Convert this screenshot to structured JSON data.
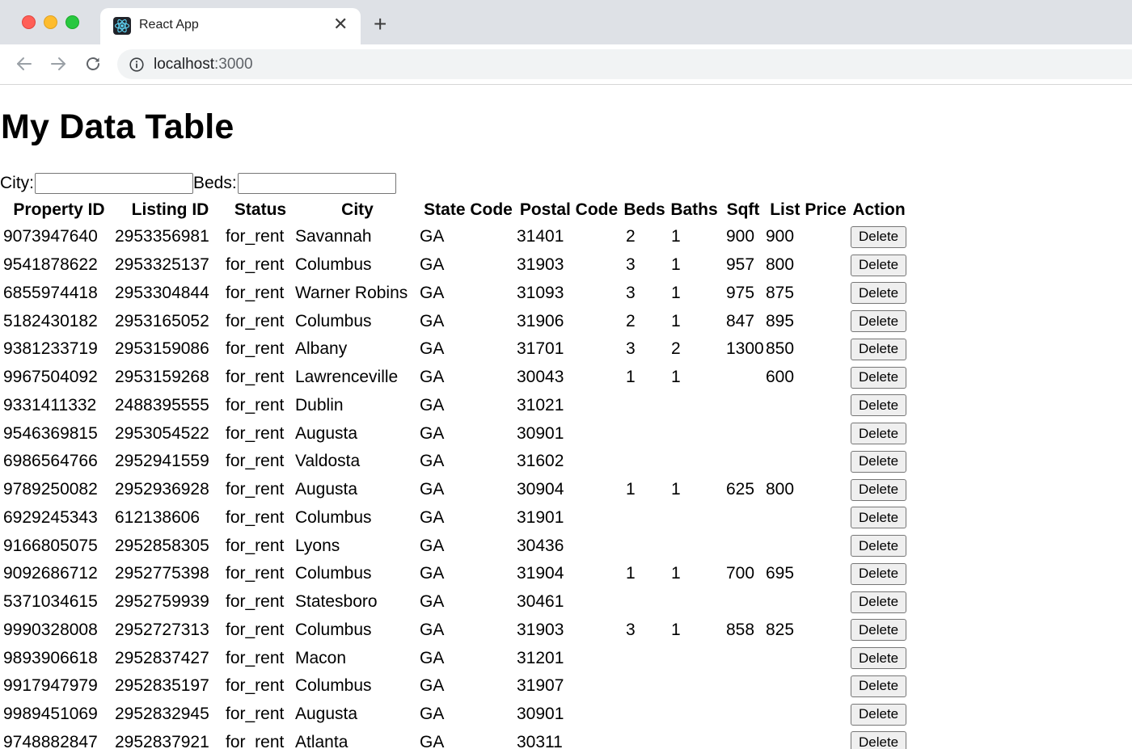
{
  "browser": {
    "tab_title": "React App",
    "tab_close": "✕",
    "new_tab": "+",
    "url_host": "localhost",
    "url_port": ":3000"
  },
  "page": {
    "title": "My Data Table",
    "filters": {
      "city_label": "City:",
      "city_value": "",
      "beds_label": "Beds:",
      "beds_value": ""
    },
    "columns": [
      "Property ID",
      "Listing ID",
      "Status",
      "City",
      "State Code",
      "Postal Code",
      "Beds",
      "Baths",
      "Sqft",
      "List Price",
      "Action"
    ],
    "delete_label": "Delete",
    "rows": [
      {
        "property_id": "9073947640",
        "listing_id": "2953356981",
        "status": "for_rent",
        "city": "Savannah",
        "state": "GA",
        "postal": "31401",
        "beds": "2",
        "baths": "1",
        "sqft": "900",
        "price": "900"
      },
      {
        "property_id": "9541878622",
        "listing_id": "2953325137",
        "status": "for_rent",
        "city": "Columbus",
        "state": "GA",
        "postal": "31903",
        "beds": "3",
        "baths": "1",
        "sqft": "957",
        "price": "800"
      },
      {
        "property_id": "6855974418",
        "listing_id": "2953304844",
        "status": "for_rent",
        "city": "Warner Robins",
        "state": "GA",
        "postal": "31093",
        "beds": "3",
        "baths": "1",
        "sqft": "975",
        "price": "875"
      },
      {
        "property_id": "5182430182",
        "listing_id": "2953165052",
        "status": "for_rent",
        "city": "Columbus",
        "state": "GA",
        "postal": "31906",
        "beds": "2",
        "baths": "1",
        "sqft": "847",
        "price": "895"
      },
      {
        "property_id": "9381233719",
        "listing_id": "2953159086",
        "status": "for_rent",
        "city": "Albany",
        "state": "GA",
        "postal": "31701",
        "beds": "3",
        "baths": "2",
        "sqft": "1300",
        "price": "850"
      },
      {
        "property_id": "9967504092",
        "listing_id": "2953159268",
        "status": "for_rent",
        "city": "Lawrenceville",
        "state": "GA",
        "postal": "30043",
        "beds": "1",
        "baths": "1",
        "sqft": "",
        "price": "600"
      },
      {
        "property_id": "9331411332",
        "listing_id": "2488395555",
        "status": "for_rent",
        "city": "Dublin",
        "state": "GA",
        "postal": "31021",
        "beds": "",
        "baths": "",
        "sqft": "",
        "price": ""
      },
      {
        "property_id": "9546369815",
        "listing_id": "2953054522",
        "status": "for_rent",
        "city": "Augusta",
        "state": "GA",
        "postal": "30901",
        "beds": "",
        "baths": "",
        "sqft": "",
        "price": ""
      },
      {
        "property_id": "6986564766",
        "listing_id": "2952941559",
        "status": "for_rent",
        "city": "Valdosta",
        "state": "GA",
        "postal": "31602",
        "beds": "",
        "baths": "",
        "sqft": "",
        "price": ""
      },
      {
        "property_id": "9789250082",
        "listing_id": "2952936928",
        "status": "for_rent",
        "city": "Augusta",
        "state": "GA",
        "postal": "30904",
        "beds": "1",
        "baths": "1",
        "sqft": "625",
        "price": "800"
      },
      {
        "property_id": "6929245343",
        "listing_id": "612138606",
        "status": "for_rent",
        "city": "Columbus",
        "state": "GA",
        "postal": "31901",
        "beds": "",
        "baths": "",
        "sqft": "",
        "price": ""
      },
      {
        "property_id": "9166805075",
        "listing_id": "2952858305",
        "status": "for_rent",
        "city": "Lyons",
        "state": "GA",
        "postal": "30436",
        "beds": "",
        "baths": "",
        "sqft": "",
        "price": ""
      },
      {
        "property_id": "9092686712",
        "listing_id": "2952775398",
        "status": "for_rent",
        "city": "Columbus",
        "state": "GA",
        "postal": "31904",
        "beds": "1",
        "baths": "1",
        "sqft": "700",
        "price": "695"
      },
      {
        "property_id": "5371034615",
        "listing_id": "2952759939",
        "status": "for_rent",
        "city": "Statesboro",
        "state": "GA",
        "postal": "30461",
        "beds": "",
        "baths": "",
        "sqft": "",
        "price": ""
      },
      {
        "property_id": "9990328008",
        "listing_id": "2952727313",
        "status": "for_rent",
        "city": "Columbus",
        "state": "GA",
        "postal": "31903",
        "beds": "3",
        "baths": "1",
        "sqft": "858",
        "price": "825"
      },
      {
        "property_id": "9893906618",
        "listing_id": "2952837427",
        "status": "for_rent",
        "city": "Macon",
        "state": "GA",
        "postal": "31201",
        "beds": "",
        "baths": "",
        "sqft": "",
        "price": ""
      },
      {
        "property_id": "9917947979",
        "listing_id": "2952835197",
        "status": "for_rent",
        "city": "Columbus",
        "state": "GA",
        "postal": "31907",
        "beds": "",
        "baths": "",
        "sqft": "",
        "price": ""
      },
      {
        "property_id": "9989451069",
        "listing_id": "2952832945",
        "status": "for_rent",
        "city": "Augusta",
        "state": "GA",
        "postal": "30901",
        "beds": "",
        "baths": "",
        "sqft": "",
        "price": ""
      },
      {
        "property_id": "9748882847",
        "listing_id": "2952837921",
        "status": "for_rent",
        "city": "Atlanta",
        "state": "GA",
        "postal": "30311",
        "beds": "",
        "baths": "",
        "sqft": "",
        "price": ""
      }
    ]
  }
}
